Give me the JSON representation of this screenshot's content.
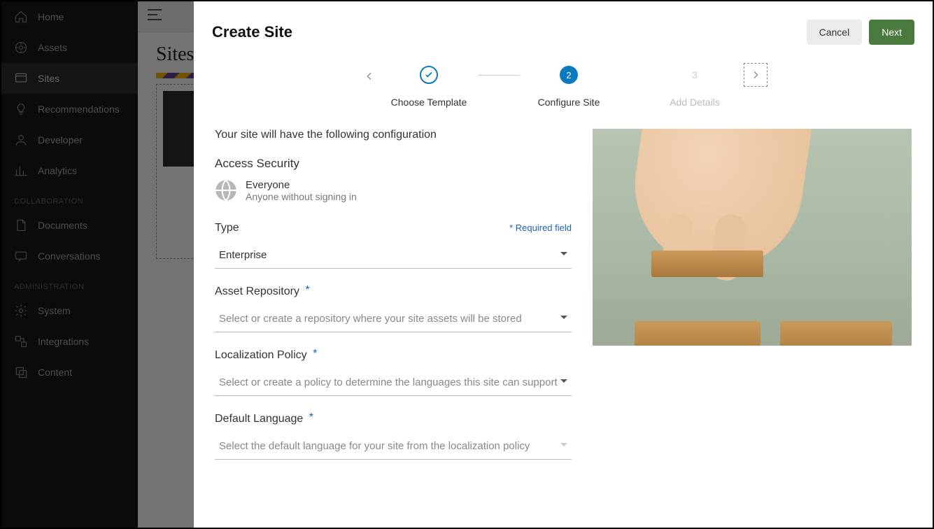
{
  "sidebar": {
    "items": [
      {
        "label": "Home"
      },
      {
        "label": "Assets"
      },
      {
        "label": "Sites"
      },
      {
        "label": "Recommendations"
      },
      {
        "label": "Developer"
      },
      {
        "label": "Analytics"
      }
    ],
    "section_collab": "COLLABORATION",
    "collab_items": [
      {
        "label": "Documents"
      },
      {
        "label": "Conversations"
      }
    ],
    "section_admin": "ADMINISTRATION",
    "admin_items": [
      {
        "label": "System"
      },
      {
        "label": "Integrations"
      },
      {
        "label": "Content"
      }
    ]
  },
  "bgpage": {
    "title": "Sites"
  },
  "modal": {
    "title": "Create Site",
    "cancel": "Cancel",
    "next": "Next",
    "steps": {
      "s1": "Choose Template",
      "s2": "Configure Site",
      "s3_num": "3",
      "s3": "Add Details"
    },
    "intro": "Your site will have the following configuration",
    "access": {
      "heading": "Access Security",
      "title": "Everyone",
      "sub": "Anyone without signing in"
    },
    "required_text": "Required field",
    "type": {
      "label": "Type",
      "value": "Enterprise"
    },
    "repo": {
      "label": "Asset Repository",
      "placeholder": "Select or create a repository where your site assets will be stored"
    },
    "loc": {
      "label": "Localization Policy",
      "placeholder": "Select or create a policy to determine the languages this site can support"
    },
    "lang": {
      "label": "Default Language",
      "placeholder": "Select the default language for your site from the localization policy"
    }
  }
}
